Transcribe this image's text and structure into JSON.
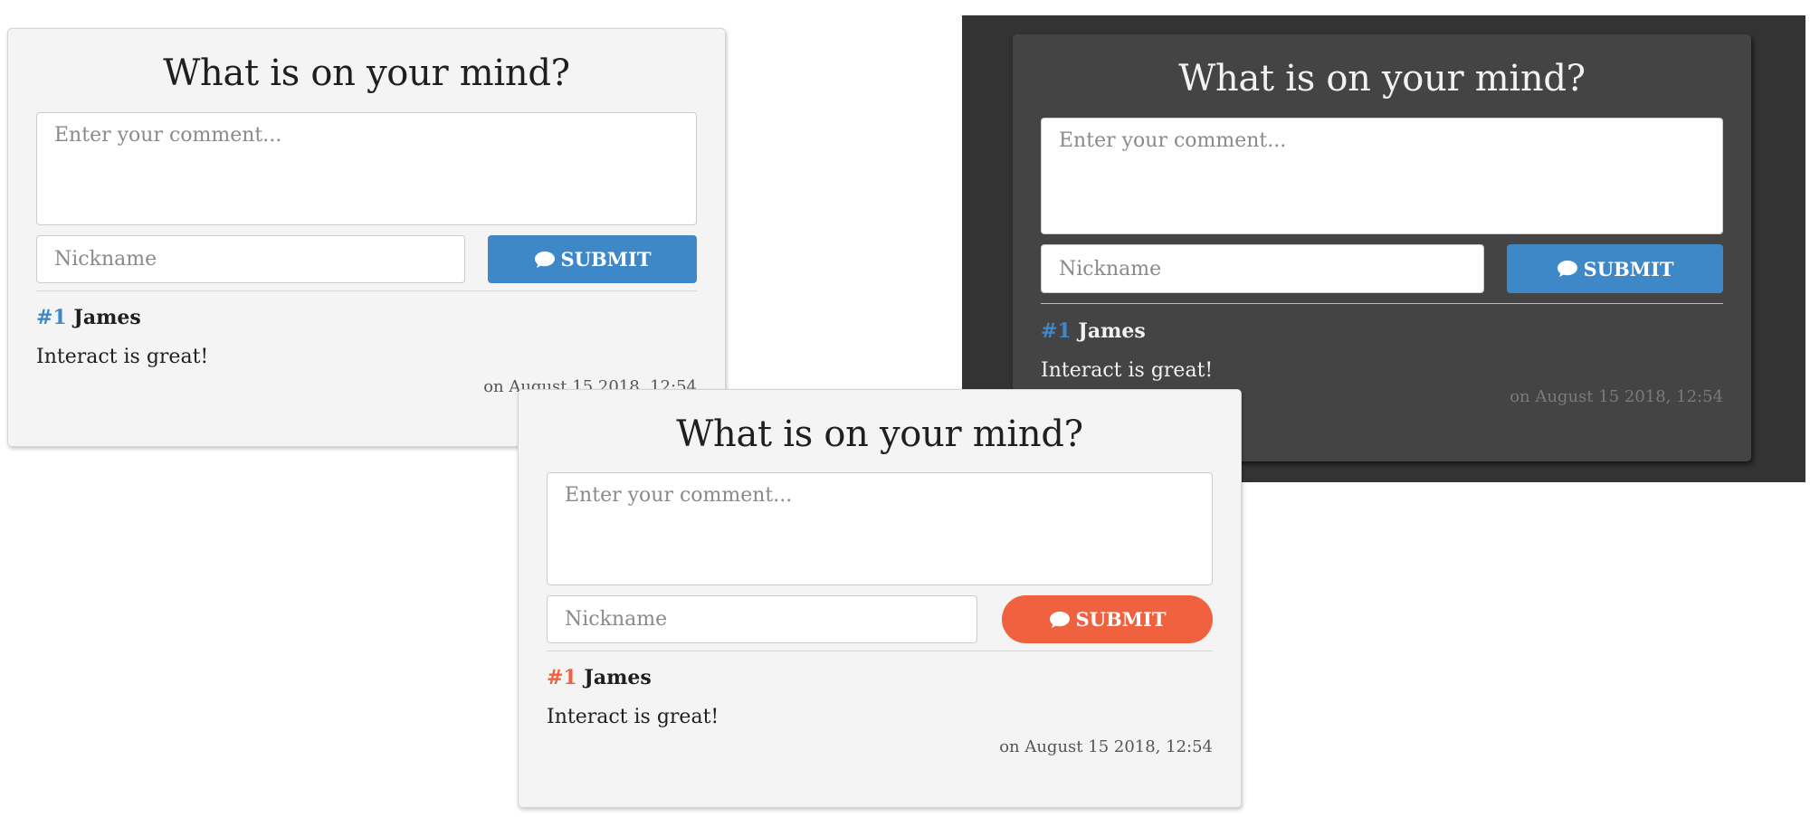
{
  "form": {
    "title": "What is on your mind?",
    "comment_placeholder": "Enter your comment...",
    "nickname_placeholder": "Nickname",
    "submit_label": "SUBMIT"
  },
  "comment": {
    "number": "#1",
    "author": "James",
    "text": "Interact is great!",
    "timestamp": "on August 15 2018, 12:54"
  },
  "variants": [
    {
      "theme": "light",
      "accent": "#3f88c8"
    },
    {
      "theme": "dark",
      "accent": "#3f88c8"
    },
    {
      "theme": "light",
      "accent": "#f06140"
    }
  ],
  "icons": {
    "submit": "comment-bubble-icon"
  }
}
